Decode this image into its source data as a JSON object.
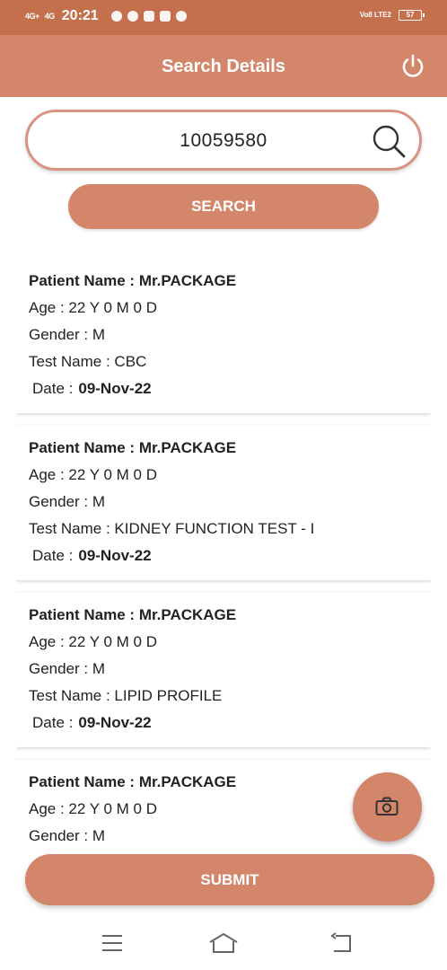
{
  "status_bar": {
    "network1": "4G+",
    "network2": "4G",
    "time": "20:21",
    "volte": "Vo8 LTE2",
    "battery": "57"
  },
  "header": {
    "title": "Search Details",
    "power_icon": "power-icon"
  },
  "search": {
    "value": "10059580",
    "icon": "search-icon",
    "button_label": "SEARCH"
  },
  "results": [
    {
      "patient_label": "Patient Name : ",
      "patient_name": "Mr.PACKAGE",
      "age": "Age : 22 Y 0 M 0 D",
      "gender": "Gender : M",
      "test": "Test Name : CBC",
      "date_label": "Date :",
      "date": "09-Nov-22"
    },
    {
      "patient_label": "Patient Name : ",
      "patient_name": "Mr.PACKAGE",
      "age": "Age : 22 Y 0 M 0 D",
      "gender": "Gender : M",
      "test": "Test Name : KIDNEY FUNCTION TEST - I",
      "date_label": "Date :",
      "date": "09-Nov-22"
    },
    {
      "patient_label": "Patient Name : ",
      "patient_name": "Mr.PACKAGE",
      "age": "Age : 22 Y 0 M 0 D",
      "gender": "Gender : M",
      "test": "Test Name : LIPID PROFILE",
      "date_label": "Date :",
      "date": "09-Nov-22"
    },
    {
      "patient_label": "Patient Name : ",
      "patient_name": "Mr.PACKAGE",
      "age": "Age : 22 Y 0 M 0 D",
      "gender": "Gender : M",
      "test": "",
      "date_label": "",
      "date": ""
    }
  ],
  "camera_fab": {
    "icon": "camera-icon"
  },
  "submit_label": "SUBMIT",
  "nav": {
    "menu_icon": "menu-icon",
    "home_icon": "home-icon",
    "back_icon": "back-icon"
  },
  "colors": {
    "status_bar": "#c4704c",
    "accent": "#d4866a",
    "search_border": "#d89486"
  }
}
